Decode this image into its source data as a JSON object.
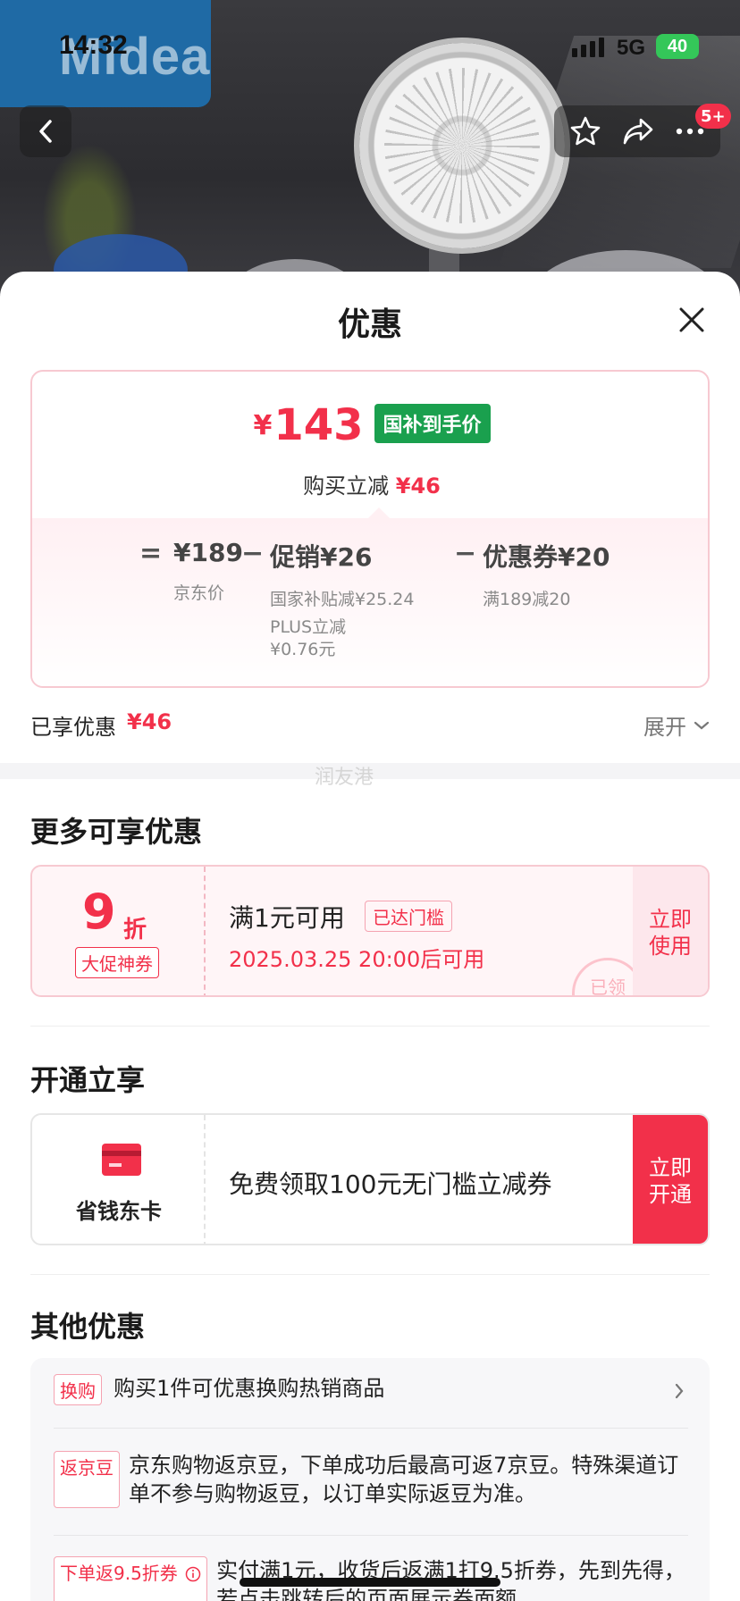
{
  "status_bar": {
    "time": "14:32",
    "network": "5G",
    "battery": "40"
  },
  "hero": {
    "brand": "Midea"
  },
  "nav": {
    "badge": "5+"
  },
  "sheet": {
    "title": "优惠",
    "price": {
      "currency": "¥",
      "final_price": "143",
      "subsidy_tag": "国补到手价",
      "reduce_label": "购买立减",
      "reduce_value": "¥46",
      "jd_price": "¥189",
      "jd_price_label": "京东价",
      "promo_label": "促销¥26",
      "promo_detail_1": "国家补贴减¥25.24",
      "promo_detail_2a": "PLUS立减",
      "promo_detail_2b": "¥0.76元",
      "coupon_label": "优惠券¥20",
      "coupon_detail": "满189减20",
      "op_equal": "=",
      "op_minus": "−"
    },
    "enjoyed": {
      "label": "已享优惠",
      "value": "¥46",
      "expand": "展开"
    },
    "watermark": "润友港",
    "more": {
      "title": "更多可享优惠",
      "coupon": {
        "rate": "9",
        "unit": "折",
        "kind": "大促神券",
        "condition": "满1元可用",
        "reached": "已达门槛",
        "time": "2025.03.25 20:00后可用",
        "action_line1": "立即",
        "action_line2": "使用",
        "stamp": "已领"
      }
    },
    "member": {
      "title": "开通立享",
      "name": "省钱东卡",
      "desc": "免费领取100元无门槛立减券",
      "action_line1": "立即",
      "action_line2": "开通"
    },
    "other": {
      "title": "其他优惠",
      "items": [
        {
          "tag": "换购",
          "text": "购买1件可优惠换购热销商品"
        },
        {
          "tag": "返京豆",
          "text": "京东购物返京豆，下单成功后最高可返7京豆。特殊渠道订单不参与购物返豆，以订单实际返豆为准。"
        },
        {
          "tag": "下单返9.5折券",
          "text": "实付满1元，收货后返满1打9.5折券，先到先得，若点击跳转后的页面展示券面额"
        }
      ]
    }
  },
  "colors": {
    "accent_red": "#f2304a",
    "subsidy_green": "#1aa04e"
  }
}
